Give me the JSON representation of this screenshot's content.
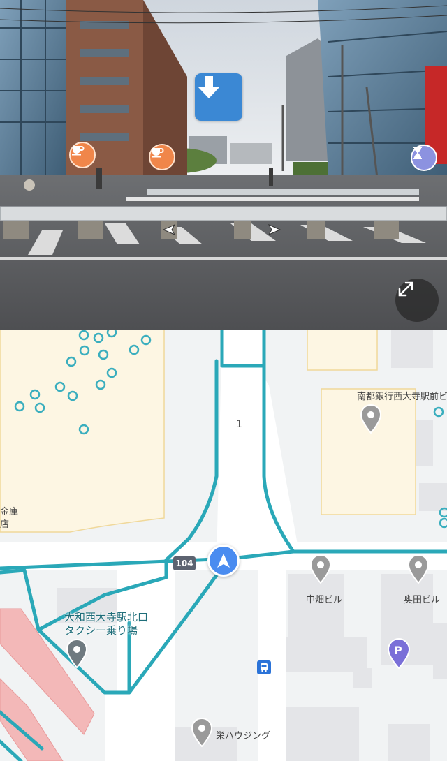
{
  "street_view": {
    "down_button_icon": "arrow-down-icon",
    "expand_button_icon": "expand-icon",
    "poi_markers": [
      "cafe-icon",
      "cafe-icon",
      "hourglass-icon"
    ],
    "nav_arrows": [
      "chevron-left-icon",
      "chevron-right-icon"
    ]
  },
  "map": {
    "lot_number": "1",
    "route_number": "104",
    "labels": {
      "bank_top": "南都銀行西大寺駅前ビ",
      "bank_left_line1": "金庫",
      "bank_left_line2": "店",
      "nakahata": "中畑ビル",
      "okuda": "奥田ビル",
      "taxi_line1": "大和西大寺駅北口",
      "taxi_line2": "タクシー乗り場",
      "sakae": "栄ハウジング"
    },
    "parking_label": "P",
    "colors": {
      "road_outline": "#2aa8b8",
      "building": "#fdf6e3",
      "rail": "#f3b8b8",
      "nav_blue": "#4a8cf0",
      "poi_gray": "#8e8e8e",
      "parking_purple": "#7a6fd8"
    }
  }
}
